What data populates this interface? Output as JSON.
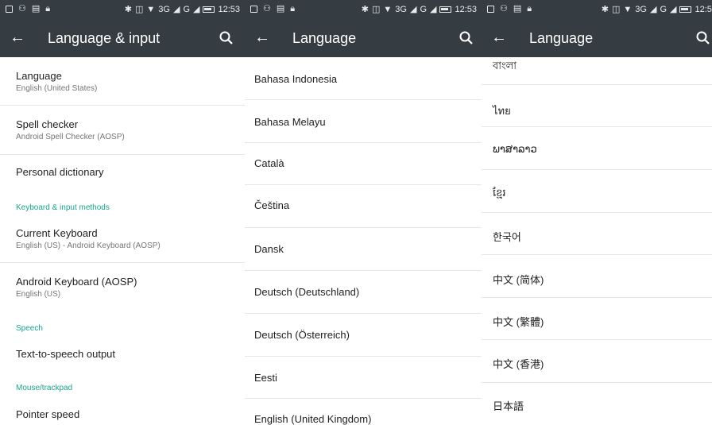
{
  "status": {
    "time": "12:53",
    "network": "3G",
    "network2": "G"
  },
  "panel1": {
    "title": "Language & input",
    "items": [
      {
        "title": "Language",
        "subtitle": "English (United States)"
      },
      {
        "title": "Spell checker",
        "subtitle": "Android Spell Checker (AOSP)"
      },
      {
        "title": "Personal dictionary"
      },
      {
        "header": "Keyboard & input methods"
      },
      {
        "title": "Current Keyboard",
        "subtitle": "English (US) - Android Keyboard (AOSP)"
      },
      {
        "title": "Android Keyboard (AOSP)",
        "subtitle": "English (US)"
      },
      {
        "header": "Speech"
      },
      {
        "title": "Text-to-speech output"
      },
      {
        "header": "Mouse/trackpad"
      },
      {
        "title": "Pointer speed"
      }
    ]
  },
  "panel2": {
    "title": "Language",
    "languages": [
      "Bahasa Indonesia",
      "Bahasa Melayu",
      "Català",
      "Čeština",
      "Dansk",
      "Deutsch (Deutschland)",
      "Deutsch (Österreich)",
      "Eesti",
      "English (United Kingdom)"
    ]
  },
  "panel3": {
    "title": "Language",
    "languages": [
      "বাংলা",
      "ไทย",
      "ພາສາລາວ",
      "ខ្មែរ",
      "한국어",
      "中文 (简体)",
      "中文 (繁體)",
      "中文 (香港)",
      "日本語"
    ]
  },
  "colors": {
    "appbar": "#353d43",
    "accent": "#18a58e"
  }
}
